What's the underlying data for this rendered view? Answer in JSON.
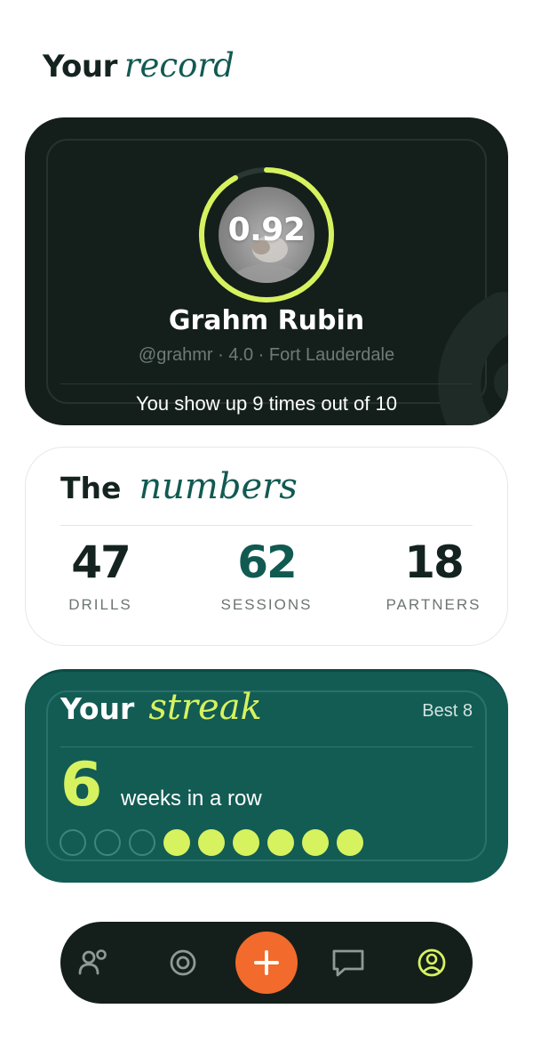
{
  "header": {
    "title_plain": "Your",
    "title_italic": "record"
  },
  "profile": {
    "score": "0.92",
    "score_fraction": 0.92,
    "name": "Grahm Rubin",
    "meta": "@grahmr · 4.0 · Fort Lauderdale",
    "reliability": "You show up 9 times out of 10"
  },
  "numbers": {
    "title_plain": "The",
    "title_italic": "numbers",
    "stats": [
      {
        "value": "47",
        "label": "DRILLS"
      },
      {
        "value": "62",
        "label": "SESSIONS"
      },
      {
        "value": "18",
        "label": "PARTNERS"
      }
    ]
  },
  "streak": {
    "title_plain": "Your",
    "title_italic": "streak",
    "best": "Best 8",
    "count": "6",
    "unit": "weeks in a row",
    "weeks": [
      false,
      false,
      false,
      true,
      true,
      true,
      true,
      true,
      true
    ]
  },
  "nav": {
    "items": [
      {
        "icon": "people-icon"
      },
      {
        "icon": "target-icon"
      },
      {
        "icon": "plus-icon"
      },
      {
        "icon": "chat-icon"
      },
      {
        "icon": "profile-icon"
      }
    ]
  },
  "colors": {
    "dark": "#141f1b",
    "teal": "#125c54",
    "lime": "#d7f25f",
    "orange": "#f26a2c"
  }
}
